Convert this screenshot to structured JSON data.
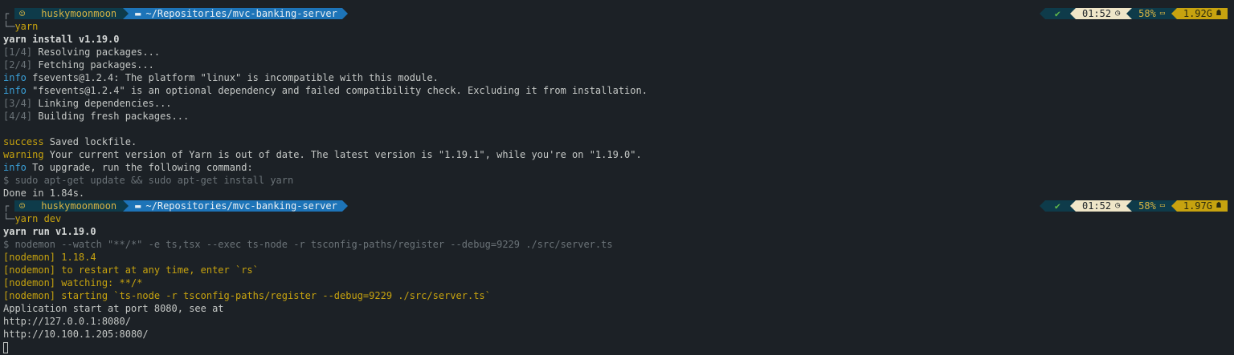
{
  "prompts": [
    {
      "user_icon": "☺",
      "user": "huskymoonmoon",
      "dir_icon": "▬",
      "dir": "~/Repositories/mvc-banking-server",
      "command": "yarn",
      "status": "✔",
      "time": "01:52",
      "time_icon": "◷",
      "battery": "58%",
      "battery_icon": "▭",
      "memory": "1.92G",
      "memory_icon": "☗"
    },
    {
      "user_icon": "☺",
      "user": "huskymoonmoon",
      "dir_icon": "▬",
      "dir": "~/Repositories/mvc-banking-server",
      "command": "yarn dev",
      "status": "✔",
      "time": "01:52",
      "time_icon": "◷",
      "battery": "58%",
      "battery_icon": "▭",
      "memory": "1.97G",
      "memory_icon": "☗"
    }
  ],
  "tree": {
    "top": "┌",
    "bottom": "└─"
  },
  "output1": {
    "header": "yarn install v1.19.0",
    "step1_tag": "[1/4]",
    "step1_text": " Resolving packages...",
    "step2_tag": "[2/4]",
    "step2_text": " Fetching packages...",
    "info1_tag": "info",
    "info1_text": " fsevents@1.2.4: The platform \"linux\" is incompatible with this module.",
    "info2_tag": "info",
    "info2_text": " \"fsevents@1.2.4\" is an optional dependency and failed compatibility check. Excluding it from installation.",
    "step3_tag": "[3/4]",
    "step3_text": " Linking dependencies...",
    "step4_tag": "[4/4]",
    "step4_text": " Building fresh packages...",
    "success_tag": "success",
    "success_text": " Saved lockfile.",
    "warning_tag": "warning",
    "warning_text": " Your current version of Yarn is out of date. The latest version is \"1.19.1\", while you're on \"1.19.0\".",
    "info3_tag": "info",
    "info3_text": " To upgrade, run the following command:",
    "upgrade_cmd": "$ sudo apt-get update && sudo apt-get install yarn",
    "done": "Done in 1.84s."
  },
  "output2": {
    "header": "yarn run v1.19.0",
    "nodemon_cmd": "$ nodemon --watch \"**/*\" -e ts,tsx --exec ts-node -r tsconfig-paths/register --debug=9229 ./src/server.ts",
    "n1": "[nodemon] 1.18.4",
    "n2": "[nodemon] to restart at any time, enter `rs`",
    "n3": "[nodemon] watching: **/*",
    "n4": "[nodemon] starting `ts-node -r tsconfig-paths/register --debug=9229 ./src/server.ts`",
    "app1": "Application start at port 8080, see at",
    "app2": "http://127.0.0.1:8080/",
    "app3": "http://10.100.1.205:8080/"
  }
}
